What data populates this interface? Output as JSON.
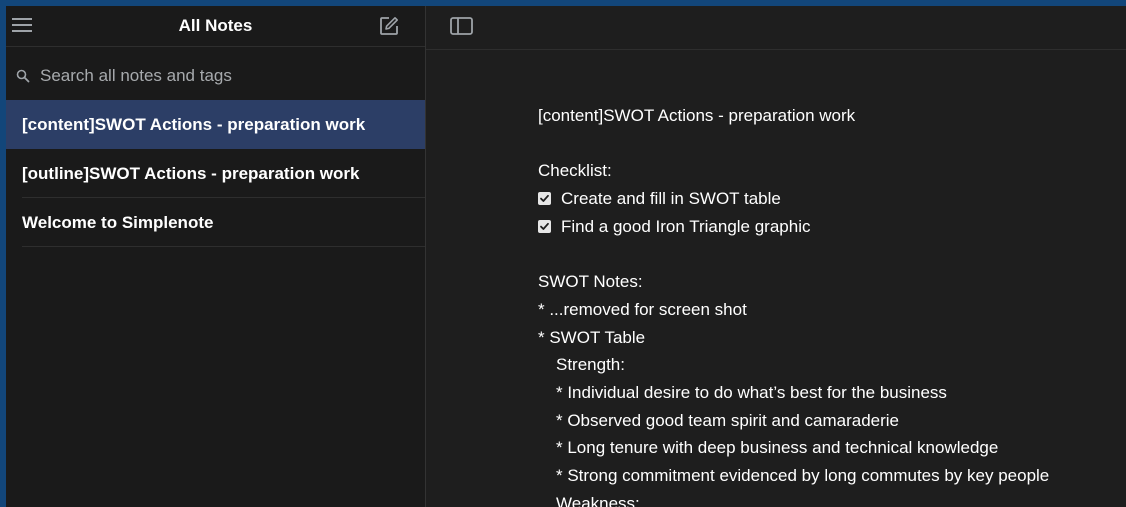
{
  "sidebar": {
    "title": "All Notes",
    "search_placeholder": "Search all notes and tags",
    "notes": [
      {
        "title": "[content]SWOT Actions - preparation work",
        "selected": true
      },
      {
        "title": "[outline]SWOT Actions - preparation work",
        "selected": false
      },
      {
        "title": "Welcome to Simplenote",
        "selected": false
      }
    ]
  },
  "editor": {
    "note_title": "[content]SWOT Actions - preparation work",
    "checklist_heading": "Checklist:",
    "checklist": [
      {
        "text": "Create and fill in SWOT table",
        "checked": true
      },
      {
        "text": "Find a good Iron Triangle graphic",
        "checked": true
      }
    ],
    "swot_heading": "SWOT Notes:",
    "swot_items": [
      "* ...removed for screen shot",
      "* SWOT Table"
    ],
    "strength_heading": "Strength:",
    "strength_items": [
      "* Individual desire to do what’s best for the business",
      "* Observed good team spirit and camaraderie",
      "* Long tenure with deep business and technical knowledge",
      "* Strong commitment evidenced by long commutes by key people"
    ],
    "weakness_heading": "Weakness:"
  },
  "colors": {
    "window_frame": "#12467a",
    "sidebar_bg": "#1a1a1a",
    "editor_bg": "#1e1e1e",
    "selected_note_bg": "#2c3e66",
    "text": "#ffffff",
    "muted_text": "#a7aaad"
  },
  "icons": {
    "menu": "hamburger-menu-icon",
    "new_note": "new-note-icon",
    "search": "search-icon",
    "sidebar_toggle": "sidebar-toggle-icon",
    "checkbox": "checkbox-checked-icon"
  }
}
